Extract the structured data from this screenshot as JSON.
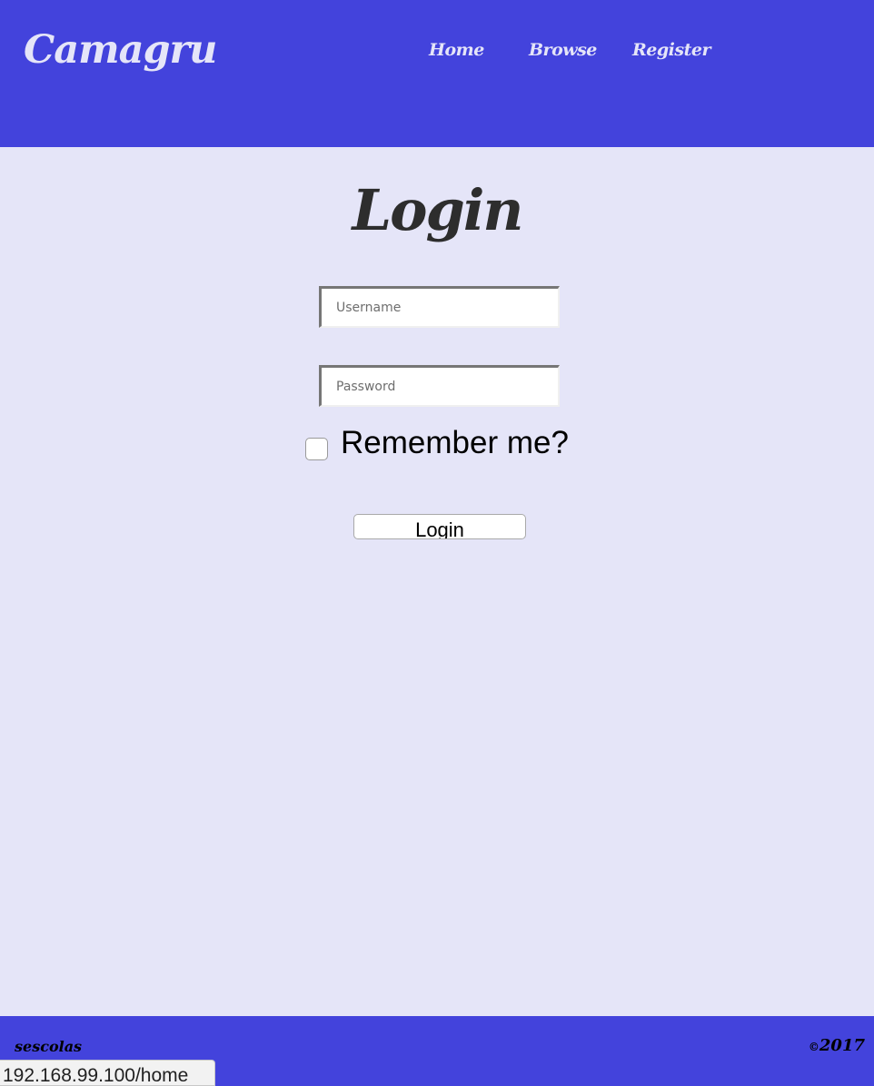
{
  "header": {
    "brand": "Camagru",
    "nav": {
      "home": "Home",
      "browse": "Browse",
      "register": "Register"
    }
  },
  "main": {
    "title": "Login",
    "username_placeholder": "Username",
    "password_placeholder": "Password",
    "remember_label": "Remember me?",
    "remember_checked": false,
    "login_button": "Login"
  },
  "footer": {
    "author": "sescolas",
    "copyright_symbol": "©",
    "year": "2017"
  },
  "status_bar": {
    "url": "192.168.99.100/home"
  },
  "colors": {
    "header_bg": "#4343dc",
    "page_bg": "#e5e5f8",
    "title_text": "#2d2d2d"
  }
}
